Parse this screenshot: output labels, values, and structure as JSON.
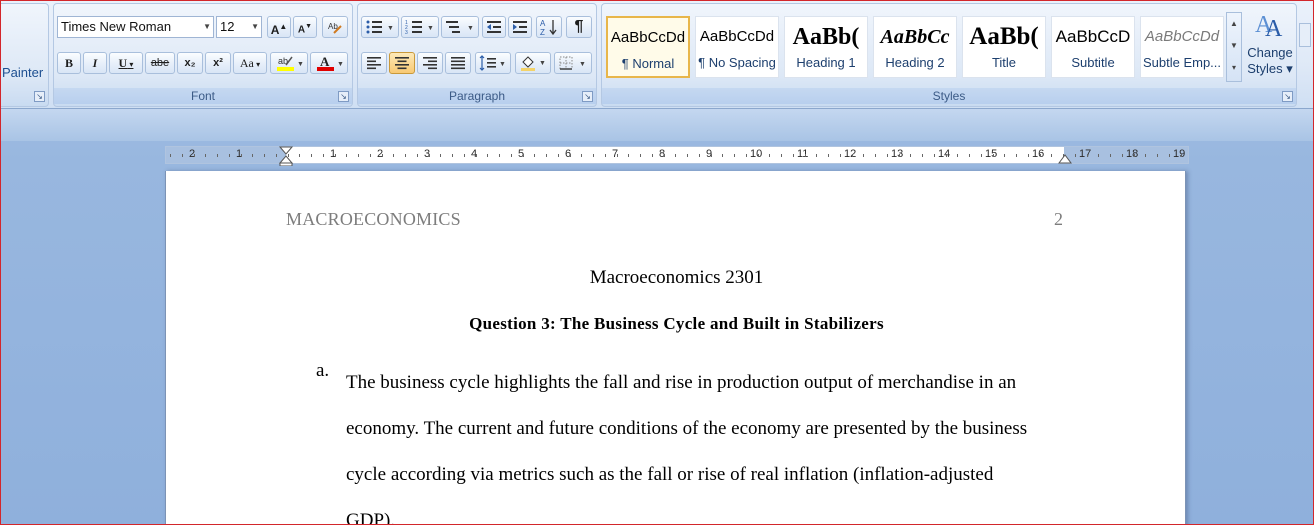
{
  "ribbon": {
    "clipboard": {
      "painter_label": "Painter"
    },
    "font": {
      "group_label": "Font",
      "font_name": "Times New Roman",
      "font_size": "12",
      "grow_label": "A",
      "shrink_label": "A",
      "bold": "B",
      "italic": "I",
      "underline": "U",
      "strikethrough": "abe",
      "subscript": "x₂",
      "superscript": "x²",
      "change_case": "Aa",
      "highlight_color": "#ffff00",
      "font_color": "#e00000"
    },
    "paragraph": {
      "group_label": "Paragraph",
      "show_marks": "¶"
    },
    "styles": {
      "group_label": "Styles",
      "items": [
        {
          "sample": "AaBbCcDd",
          "name": "¶ Normal"
        },
        {
          "sample": "AaBbCcDd",
          "name": "¶ No Spacing"
        },
        {
          "sample": "AaBb(",
          "name": "Heading 1"
        },
        {
          "sample": "AaBbCc",
          "name": "Heading 2"
        },
        {
          "sample": "AaBb(",
          "name": "Title"
        },
        {
          "sample": "AaBbCcD",
          "name": "Subtitle"
        },
        {
          "sample": "AaBbCcDd",
          "name": "Subtle Emp..."
        }
      ],
      "change_styles_line1": "Change",
      "change_styles_line2": "Styles ▾"
    }
  },
  "ruler": {
    "ticks": [
      "2",
      "1",
      "1",
      "2",
      "3",
      "4",
      "5",
      "6",
      "7",
      "8",
      "9",
      "10",
      "11",
      "12",
      "13",
      "14",
      "15",
      "16",
      "17",
      "18",
      "19"
    ]
  },
  "document": {
    "header_left": "MACROECONOMICS",
    "header_page_number": "2",
    "title": "Macroeconomics 2301",
    "subtitle": "Question 3: The Business Cycle and Built in Stabilizers",
    "list_marker": "a.",
    "paragraph_lines": [
      "The business cycle highlights the fall and rise in production output of merchandise in an",
      "economy. The current and future conditions of the economy are presented by the business",
      "cycle according via metrics such as the fall or rise of real inflation (inflation-adjusted",
      "GDP)."
    ]
  }
}
